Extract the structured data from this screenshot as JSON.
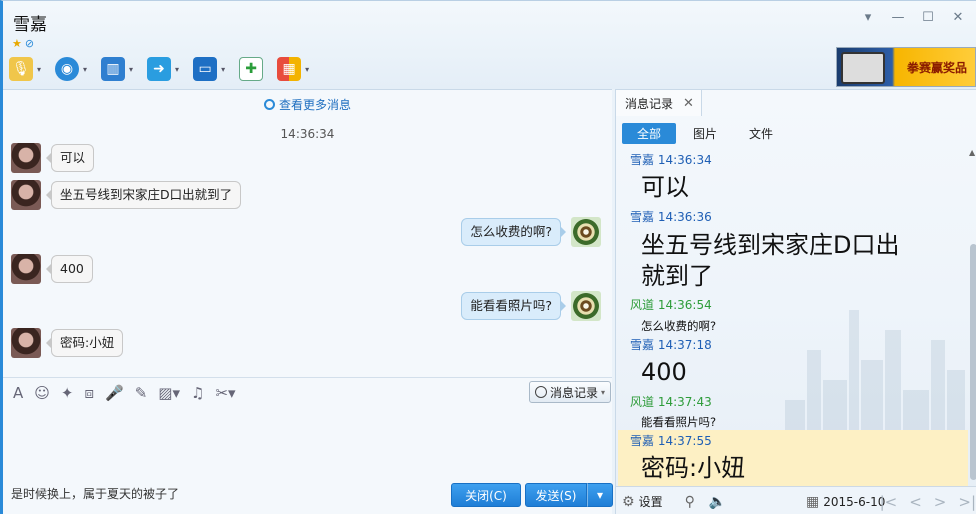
{
  "window": {
    "title": "雪嘉",
    "controls": [
      "▾",
      "—",
      "☐",
      "✕"
    ]
  },
  "toolbar": {
    "arrow": "▾"
  },
  "ad": {
    "text": "拳赛赢奖品"
  },
  "chat": {
    "more_history": "查看更多消息",
    "timestamp": "14:36:34",
    "messages": [
      {
        "side": "left",
        "text": "可以"
      },
      {
        "side": "left",
        "text": "坐五号线到宋家庄D口出就到了"
      },
      {
        "side": "right",
        "text": "怎么收费的啊?"
      },
      {
        "side": "left",
        "text": "400"
      },
      {
        "side": "right",
        "text": "能看看照片吗?"
      },
      {
        "side": "left",
        "text": "密码:小妞"
      }
    ]
  },
  "input": {
    "history_button": "消息记录",
    "typed_text": "是时候换上，属于夏天的被子了",
    "close_button": "关闭(C)",
    "send_button": "发送(S)",
    "dropdown": "▾"
  },
  "history": {
    "tab": "消息记录",
    "filters": [
      "全部",
      "图片",
      "文件"
    ],
    "entries": [
      {
        "header": "雪嘉 14:36:34",
        "text": "可以"
      },
      {
        "header": "雪嘉 14:36:36",
        "text_line1": "坐五号线到宋家庄D口出",
        "text_line2": "就到了"
      },
      {
        "header": "风道 14:36:54",
        "text": "怎么收费的啊?"
      },
      {
        "header": "雪嘉 14:37:18",
        "text": "400"
      },
      {
        "header": "风道 14:37:43",
        "text": "能看看照片吗?"
      },
      {
        "header": "雪嘉 14:37:55",
        "text": "密码:小妞"
      }
    ],
    "settings": "设置",
    "date": "2015-6-10"
  }
}
